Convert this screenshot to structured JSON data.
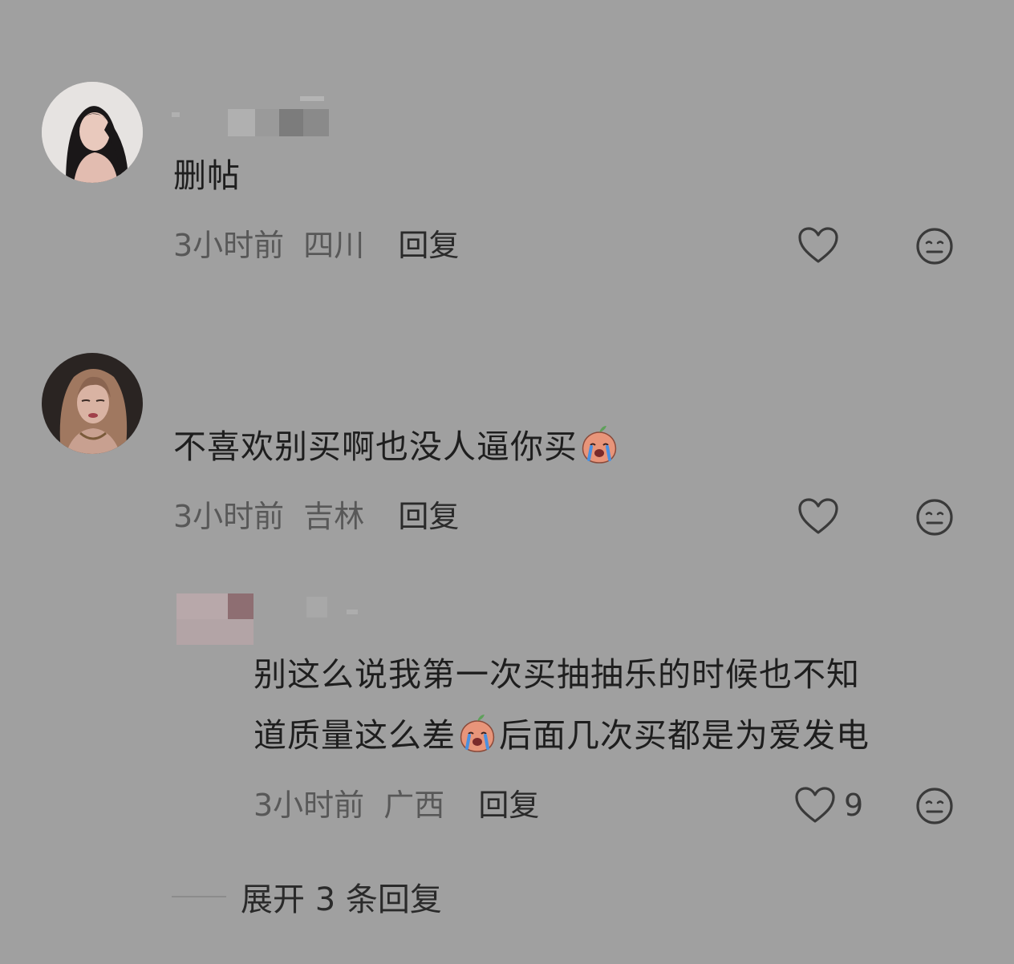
{
  "comments": [
    {
      "body": "删帖",
      "time": "3小时前",
      "location": "四川",
      "reply_label": "回复",
      "like_count": ""
    },
    {
      "body": "不喜欢别买啊也没人逼你买",
      "time": "3小时前",
      "location": "吉林",
      "reply_label": "回复",
      "like_count": ""
    }
  ],
  "reply": {
    "body_line1": "别这么说我第一次买抽抽乐的时候也不知",
    "body_line2_a": "道质量这么差",
    "body_line2_b": "后面几次买都是为爱发电",
    "time": "3小时前",
    "location": "广西",
    "reply_label": "回复",
    "like_count": "9"
  },
  "expand_replies_label": "展开 3 条回复",
  "icons": {
    "like": "heart-outline-icon",
    "dislike": "meh-face-icon",
    "emoji": "crying-peach-emoji"
  },
  "colors": {
    "background": "#a0a0a0",
    "text_primary": "#1e1e1e",
    "text_secondary": "#585858"
  }
}
